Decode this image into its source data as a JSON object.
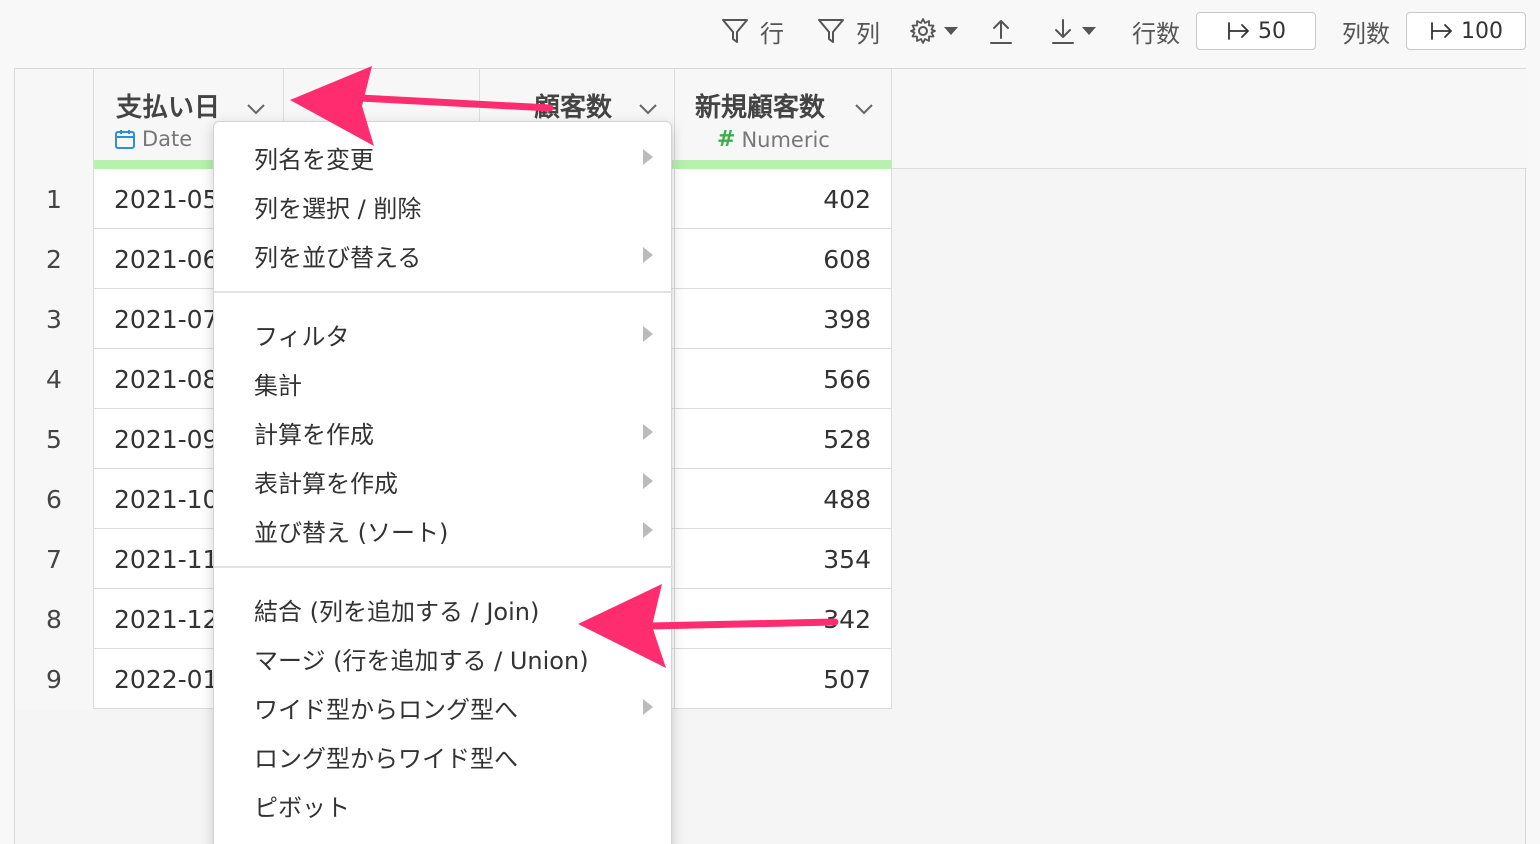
{
  "toolbar": {
    "row_filter_label": "行",
    "col_filter_label": "列",
    "rows_label": "行数",
    "rows_value": "50",
    "cols_label": "列数",
    "cols_value": "100"
  },
  "columns": [
    {
      "title": "支払い日",
      "type": "Date",
      "type_icon": "calendar-icon"
    },
    {
      "title": "",
      "type": ""
    },
    {
      "title": "顧客数",
      "type": ""
    },
    {
      "title": "新規顧客数",
      "type": "Numeric",
      "type_icon": "hash-icon"
    }
  ],
  "rows": [
    {
      "index": "1",
      "date": "2021-05",
      "new_customers": "402"
    },
    {
      "index": "2",
      "date": "2021-06",
      "new_customers": "608"
    },
    {
      "index": "3",
      "date": "2021-07",
      "new_customers": "398"
    },
    {
      "index": "4",
      "date": "2021-08",
      "new_customers": "566"
    },
    {
      "index": "5",
      "date": "2021-09",
      "new_customers": "528"
    },
    {
      "index": "6",
      "date": "2021-10",
      "new_customers": "488"
    },
    {
      "index": "7",
      "date": "2021-11",
      "new_customers": "354"
    },
    {
      "index": "8",
      "date": "2021-12",
      "new_customers": "342"
    },
    {
      "index": "9",
      "date": "2022-01",
      "new_customers": "507"
    }
  ],
  "menu": {
    "groups": [
      [
        {
          "label": "列名を変更",
          "submenu": true
        },
        {
          "label": "列を選択 / 削除",
          "submenu": false
        },
        {
          "label": "列を並び替える",
          "submenu": true
        }
      ],
      [
        {
          "label": "フィルタ",
          "submenu": true
        },
        {
          "label": "集計",
          "submenu": false
        },
        {
          "label": "計算を作成",
          "submenu": true
        },
        {
          "label": "表計算を作成",
          "submenu": true
        },
        {
          "label": "並び替え (ソート)",
          "submenu": true
        }
      ],
      [
        {
          "label": "結合 (列を追加する / Join)",
          "submenu": false
        },
        {
          "label": "マージ (行を追加する / Union)",
          "submenu": false
        },
        {
          "label": "ワイド型からロング型へ",
          "submenu": true
        },
        {
          "label": "ロング型からワイド型へ",
          "submenu": false
        },
        {
          "label": "ピボット",
          "submenu": false
        }
      ]
    ]
  },
  "colors": {
    "accent_arrow": "#ff2d6f",
    "type_bar": "#b6f2ae",
    "date_icon": "#2e8fd6",
    "numeric_icon": "#3fae4a"
  }
}
